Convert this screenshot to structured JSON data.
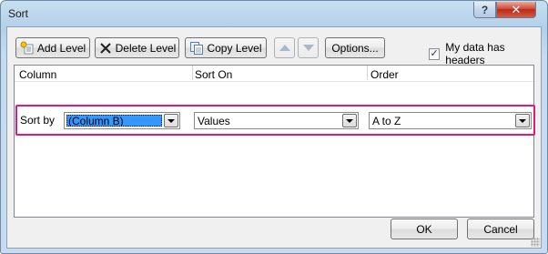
{
  "window": {
    "title": "Sort",
    "help_label": "?",
    "close_label": "✕"
  },
  "toolbar": {
    "add_level_label": "Add Level",
    "delete_level_label": "Delete Level",
    "copy_level_label": "Copy Level",
    "options_label": "Options...",
    "my_data_has_headers_label": "My data has headers",
    "my_data_has_headers_checked": true
  },
  "grid": {
    "columns": [
      "Column",
      "Sort On",
      "Order"
    ],
    "rows": [
      {
        "label": "Sort by",
        "column": "(Column B)",
        "sort_on": "Values",
        "order": "A to Z"
      }
    ],
    "highlight_color": "#e5197a"
  },
  "footer": {
    "ok_label": "OK",
    "cancel_label": "Cancel"
  },
  "icons": {
    "add_level": "add-level-icon",
    "delete_level": "delete-x-icon",
    "copy_level": "copy-icon",
    "move_up": "arrow-up-icon",
    "move_down": "arrow-down-icon"
  }
}
